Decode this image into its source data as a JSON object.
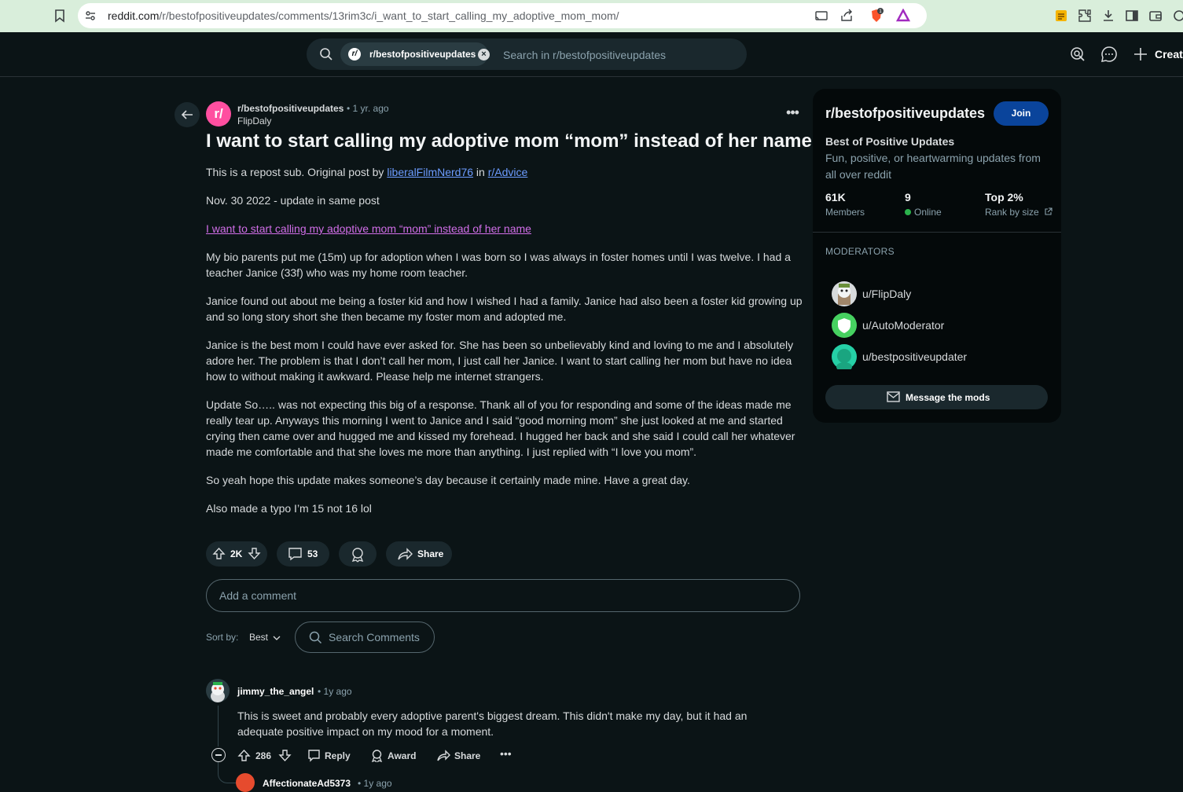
{
  "browser": {
    "url_domain": "reddit.com",
    "url_path": "/r/bestofpositiveupdates/comments/13rim3c/i_want_to_start_calling_my_adoptive_mom_mom/",
    "brave_badge": "1"
  },
  "header": {
    "search_chip": "r/bestofpositiveupdates",
    "search_placeholder": "Search in r/bestofpositiveupdates",
    "create_label": "Create"
  },
  "post": {
    "subreddit": "r/bestofpositiveupdates",
    "subreddit_icon": "r/",
    "time": "• 1 yr. ago",
    "author": "FlipDaly",
    "title": "I want to start calling my adoptive mom “mom” instead of her name",
    "intro_text": "This is a repost sub. Original post by ",
    "intro_user": "liberalFilmNerd76",
    "intro_in": " in ",
    "intro_sub": "r/Advice",
    "date_line": "Nov. 30 2022 - update in same post",
    "link_text": "I want to start calling my adoptive mom “mom” instead of her name",
    "paragraphs": [
      "My bio parents put me (15m) up for adoption when I was born so I was always in foster homes until I was twelve. I had a teacher Janice (33f) who was my home room teacher.",
      "Janice found out about me being a foster kid and how I wished I had a family. Janice had also been a foster kid growing up and so long story short she then became my foster mom and adopted me.",
      "Janice is the best mom I could have ever asked for. She has been so unbelievably kind and loving to me and I absolutely adore her. The problem is that I don’t call her mom, I just call her Janice. I want to start calling her mom but have no idea how to without making it awkward. Please help me internet strangers.",
      "Update So….. was not expecting this big of a response. Thank all of you for responding and some of the ideas made me really tear up. Anyways this morning I went to Janice and I said “good morning mom” she just looked at me and started crying then came over and hugged me and kissed my forehead. I hugged her back and she said I could call her whatever made me comfortable and that she loves me more than anything. I just replied with “I love you mom”.",
      "So yeah hope this update makes someone’s day because it certainly made mine. Have a great day.",
      "Also made a typo I’m 15 not 16 lol"
    ],
    "votes": "2K",
    "comments": "53",
    "share_label": "Share"
  },
  "comment_box": {
    "placeholder": "Add a comment"
  },
  "sort": {
    "label": "Sort by:",
    "value": "Best",
    "search_placeholder": "Search Comments"
  },
  "comment": {
    "user": "jimmy_the_angel",
    "time": "• 1y ago",
    "text": "This is sweet and probably every adoptive parent's biggest dream. This didn't make my day, but it had an adequate positive impact on my mood for a moment.",
    "votes": "286",
    "reply_label": "Reply",
    "award_label": "Award",
    "share_label": "Share",
    "reply_user": "AffectionateAd5373",
    "reply_time": "• 1y ago"
  },
  "sidebar": {
    "title": "r/bestofpositiveupdates",
    "join_label": "Join",
    "subtitle": "Best of Positive Updates",
    "description": "Fun, positive, or heartwarming updates from all over reddit",
    "stats": [
      {
        "value": "61K",
        "label": "Members"
      },
      {
        "value": "9",
        "label": "Online"
      },
      {
        "value": "Top 2%",
        "label": "Rank by size"
      }
    ],
    "moderators_heading": "MODERATORS",
    "moderators": [
      "u/FlipDaly",
      "u/AutoModerator",
      "u/bestpositiveupdater"
    ],
    "message_label": "Message the mods"
  },
  "colors": {
    "background": "#0b1416",
    "join_button": "#0a449b",
    "subreddit_icon": "#ff4fa0",
    "link": "#6c9cff",
    "visited_link": "#d16ee8"
  }
}
